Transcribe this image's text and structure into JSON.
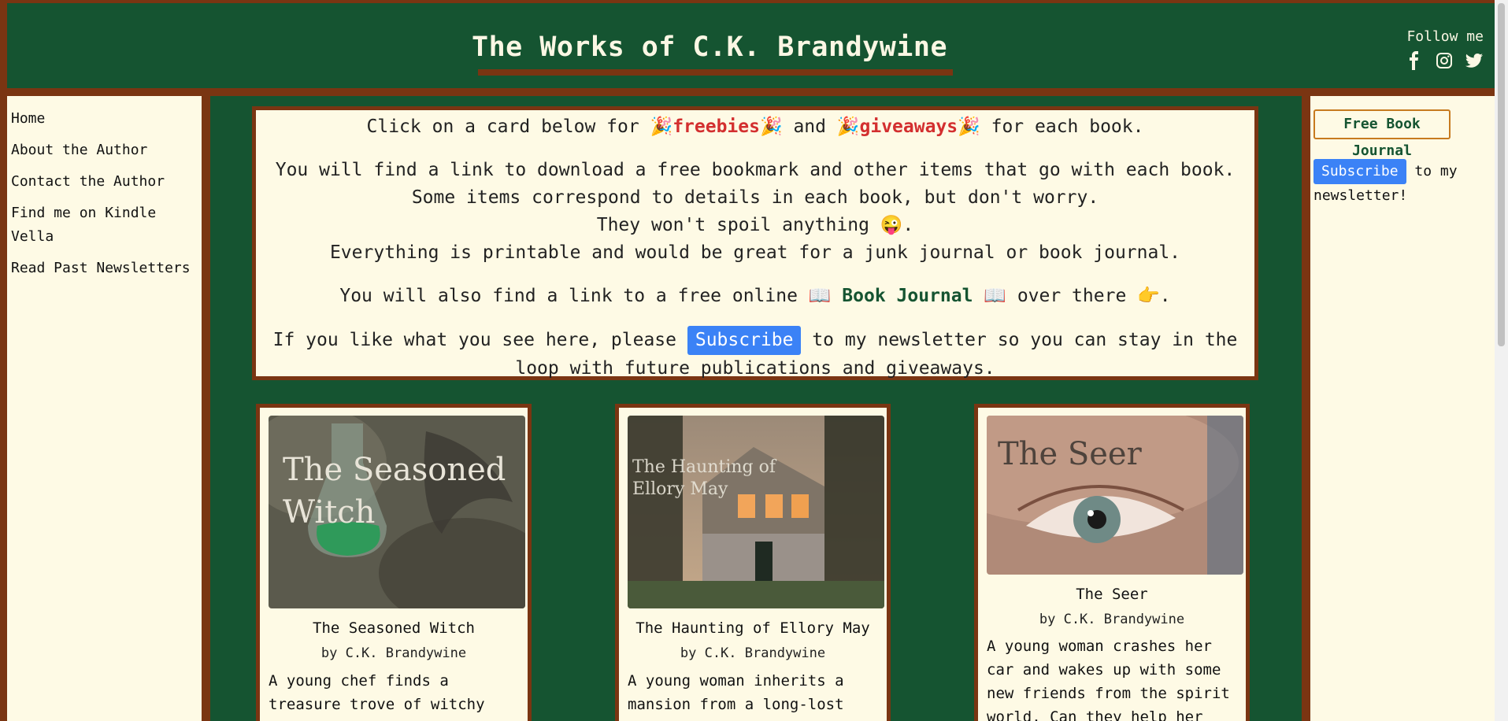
{
  "header": {
    "title": "The Works of C.K. Brandywine",
    "follow_label": "Follow me",
    "social_icons": [
      "facebook-icon",
      "instagram-icon",
      "twitter-icon"
    ]
  },
  "sidebar": {
    "items": [
      {
        "label": "Home"
      },
      {
        "label": "About the Author"
      },
      {
        "label": "Contact the Author"
      },
      {
        "label": "Find me on Kindle Vella"
      },
      {
        "label": "Read Past Newsletters"
      }
    ]
  },
  "intro": {
    "line1_pre": "Click on a card below for ",
    "freebies": "freebies",
    "line1_mid": " and ",
    "giveaways": "giveaways",
    "line1_post": " for each book.",
    "party_emoji": "🎉",
    "p2_line1": "You will find a link to download a free bookmark and other items that go with each book.",
    "p2_line2": "Some items correspond to details in each book, but don't worry.",
    "p2_line3": "They won't spoil anything 😜.",
    "p2_line4": "Everything is printable and would be great for a junk journal or book journal.",
    "p3_pre": "You will also find a link to a free online ",
    "book_emoji": "📖",
    "book_journal": "Book Journal",
    "p3_post": " over there 👉.",
    "p4_pre": "If you like what you see here, please ",
    "subscribe": "Subscribe",
    "p4_post": " to my newsletter so you can stay in the loop with future publications and giveaways."
  },
  "cards": [
    {
      "cover_text": [
        "The Seasoned",
        "Witch"
      ],
      "title": "The Seasoned Witch",
      "author": "by C.K. Brandywine",
      "description": "A young chef finds a treasure trove of witchy grimoires in"
    },
    {
      "cover_text": [
        "The Haunting of",
        "Ellory May"
      ],
      "title": "The Haunting of Ellory May",
      "author": "by C.K. Brandywine",
      "description": "A young woman inherits a mansion from a long-lost"
    },
    {
      "cover_text": [
        "The Seer"
      ],
      "title": "The Seer",
      "author": "by C.K. Brandywine",
      "description": "A young woman crashes her car and wakes up with some new friends from the spirit world. Can they help her"
    }
  ],
  "right": {
    "journal_button": "Free Book Journal",
    "subscribe": "Subscribe",
    "subscribe_post": " to my newsletter!"
  },
  "colors": {
    "header_green": "#155431",
    "frame_brown": "#7a3512",
    "cream": "#fefae5",
    "accent_red": "#d32f2f",
    "button_blue": "#3b82f6"
  }
}
